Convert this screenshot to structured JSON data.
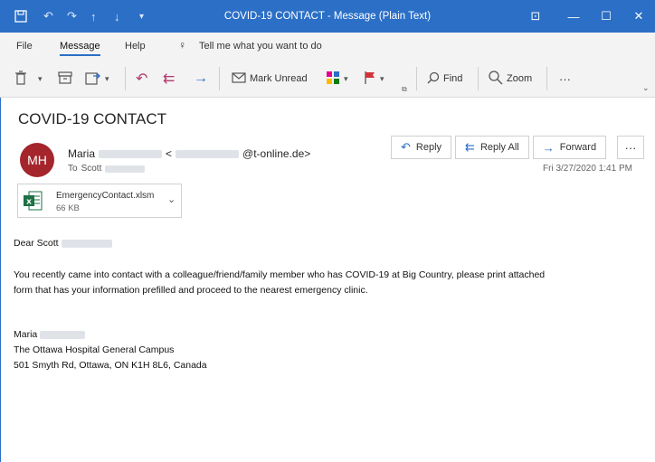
{
  "window": {
    "title": "COVID-19 CONTACT  -  Message (Plain Text)",
    "controls": {
      "ribbon_display": "⊡",
      "minimize": "—",
      "maximize": "☐",
      "close": "✕"
    }
  },
  "menu": {
    "items": [
      "File",
      "Message",
      "Help"
    ],
    "search_placeholder": "Tell me what you want to do"
  },
  "ribbon": {
    "mark_unread": "Mark Unread",
    "find": "Find",
    "zoom": "Zoom",
    "more": "···"
  },
  "message": {
    "subject": "COVID-19 CONTACT",
    "avatar_initials": "MH",
    "sender_first": "Maria",
    "sender_email_domain": "@t-online.de>",
    "sender_email_open": "<",
    "to_label": "To",
    "to_name": "Scott",
    "datetime": "Fri 3/27/2020 1:41 PM",
    "actions": {
      "reply": "Reply",
      "reply_all": "Reply All",
      "forward": "Forward",
      "more": "···"
    },
    "attachment": {
      "name": "EmergencyContact.xlsm",
      "size": "66 KB"
    }
  },
  "body": {
    "greeting": "Dear Scott",
    "line1": "You recently came into contact with a colleague/friend/family member who has COVID-19 at  Big Country, please print attached",
    "line2": "form that has your information prefilled and proceed to the nearest emergency clinic.",
    "sig_name": "Maria",
    "sig_org": "The Ottawa Hospital General Campus",
    "sig_address": "501 Smyth Rd, Ottawa, ON K1H 8L6, Canada"
  },
  "colors": {
    "accent": "#2b6fc6",
    "avatar": "#a4262c",
    "excel": "#1e7145"
  }
}
